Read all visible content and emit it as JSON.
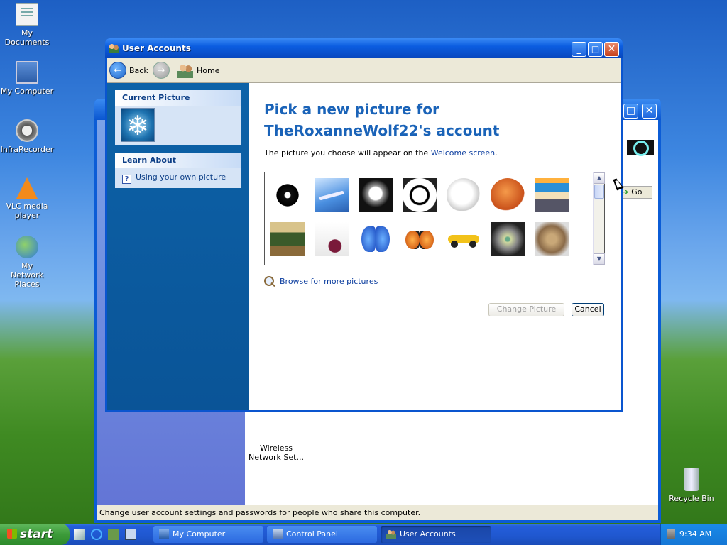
{
  "desktop": {
    "icons": [
      {
        "label": "My Documents",
        "icon": "my-documents-icon"
      },
      {
        "label": "My Computer",
        "icon": "my-computer-icon"
      },
      {
        "label": "InfraRecorder",
        "icon": "infrarecorder-icon"
      },
      {
        "label": "VLC media player",
        "icon": "vlc-icon"
      },
      {
        "label": "My Network Places",
        "icon": "network-icon"
      },
      {
        "label": "Recycle Bin",
        "icon": "recycle-bin-icon"
      }
    ]
  },
  "background_window": {
    "go_label": "Go",
    "wireless_label": "Wireless Network Set...",
    "status_text": "Change user account settings and passwords for people who share this computer."
  },
  "window": {
    "title": "User Accounts",
    "toolbar": {
      "back_label": "Back",
      "home_label": "Home"
    },
    "left_pane": {
      "current_picture_heading": "Current Picture",
      "current_picture_icon": "snowflake",
      "learn_about_heading": "Learn About",
      "learn_about_link": "Using your own picture"
    },
    "main": {
      "title": "Pick a new picture for TheRoxanneWolf22's account",
      "description_before": "The picture you choose will appear on the ",
      "description_link": "Welcome screen",
      "description_after": ".",
      "pictures": [
        "8-ball",
        "airplane",
        "astronaut",
        "soccer-ball",
        "baseball",
        "basketball",
        "beach-chair",
        "bonsai",
        "bowling",
        "blue-butterfly",
        "orange-butterfly",
        "race-car",
        "owl",
        "cat"
      ],
      "browse_label": "Browse for more pictures",
      "change_button": "Change Picture",
      "cancel_button": "Cancel"
    }
  },
  "taskbar": {
    "start_label": "start",
    "buttons": [
      {
        "label": "My Computer"
      },
      {
        "label": "Control Panel"
      },
      {
        "label": "User Accounts"
      }
    ],
    "clock": "9:34 AM"
  },
  "colors": {
    "title_blue": "#1a63b8",
    "pane_blue": "#0c60a3",
    "xp_title": "#0b5de0"
  }
}
